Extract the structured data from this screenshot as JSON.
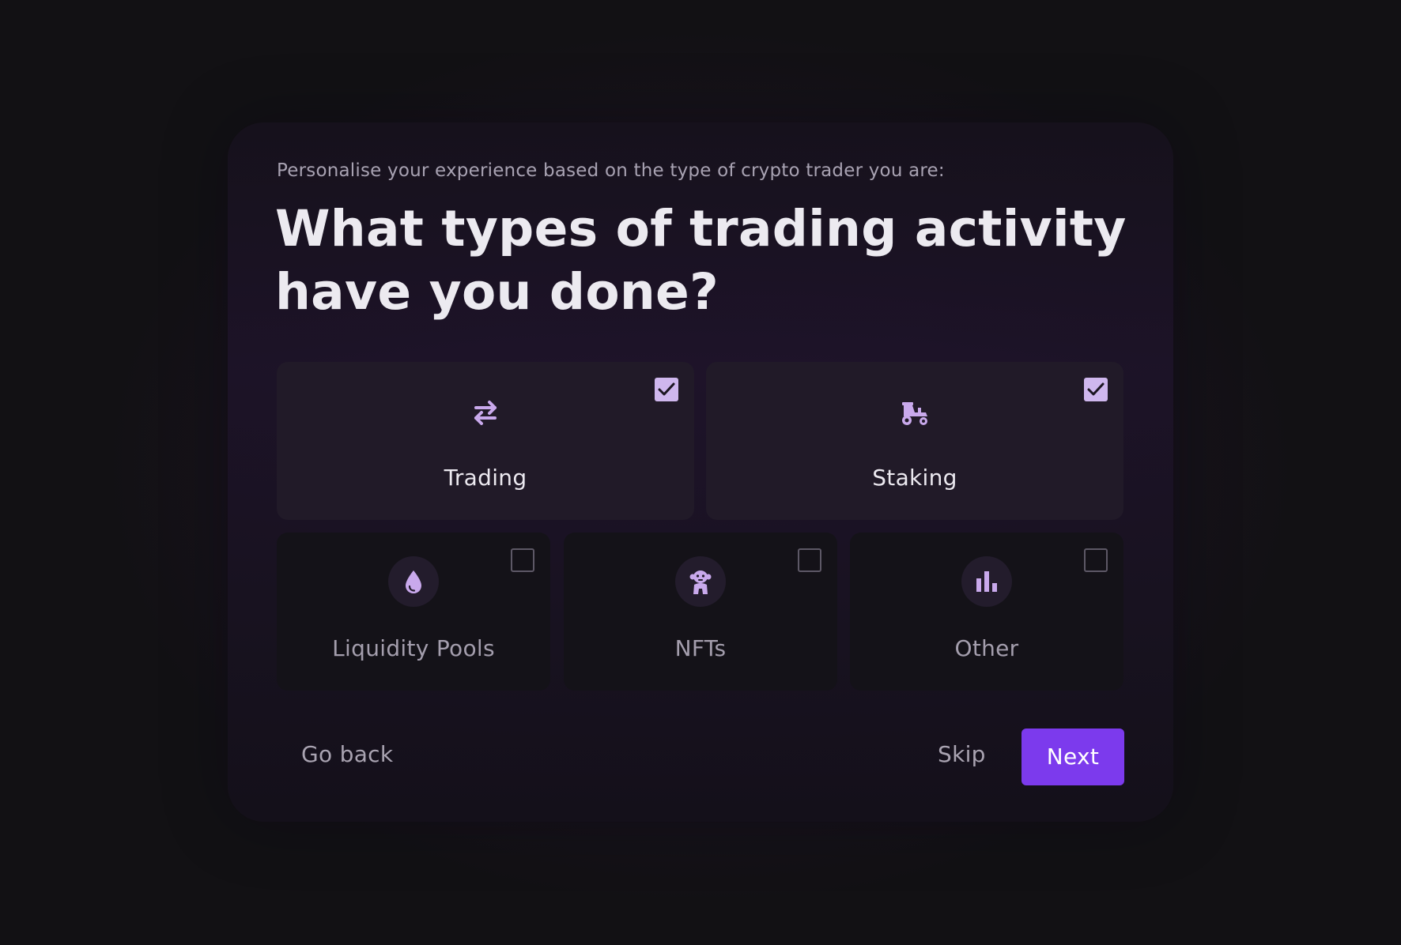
{
  "header": {
    "subtitle": "Personalise your experience based on the type of crypto trader you are:",
    "title": "What types of trading activity have you done?"
  },
  "options": [
    {
      "label": "Trading",
      "icon": "arrows-exchange-icon",
      "checked": true
    },
    {
      "label": "Staking",
      "icon": "tractor-icon",
      "checked": true
    },
    {
      "label": "Liquidity Pools",
      "icon": "droplet-icon",
      "checked": false
    },
    {
      "label": "NFTs",
      "icon": "ape-icon",
      "checked": false
    },
    {
      "label": "Other",
      "icon": "bar-chart-icon",
      "checked": false
    }
  ],
  "footer": {
    "back_label": "Go back",
    "skip_label": "Skip",
    "next_label": "Next"
  },
  "colors": {
    "accent": "#7c3aed",
    "checkbox_checked": "#cfb7ee",
    "icon": "#c9a9ec"
  }
}
